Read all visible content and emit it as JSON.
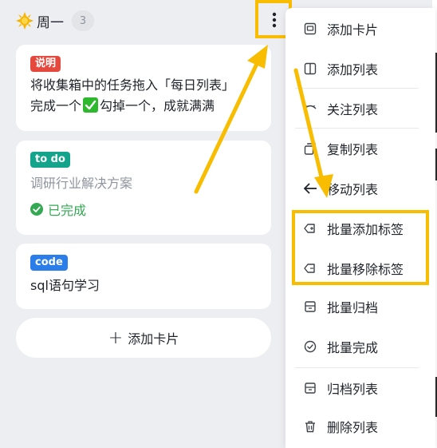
{
  "list": {
    "title": "周一",
    "count": "3"
  },
  "cards": [
    {
      "tag": "说明",
      "tag_color": "#e5483d",
      "text_a": "将收集箱中的任务拖入「每日列表」",
      "text_b1": "完成一个",
      "text_b2": "勾掉一个，成就满满"
    },
    {
      "tag": "to do",
      "tag_color": "#14a38b",
      "text": "调研行业解决方案",
      "status": "已完成"
    },
    {
      "tag": "code",
      "tag_color": "#2b7de9",
      "text": "sql语句学习"
    }
  ],
  "add_card_label": "添加卡片",
  "menu": {
    "items": [
      {
        "label": "添加卡片",
        "icon": "card-icon"
      },
      {
        "label": "添加列表",
        "icon": "columns-icon"
      },
      {
        "label": "关注列表",
        "icon": "eye-icon"
      },
      {
        "label": "复制列表",
        "icon": "copy-icon"
      },
      {
        "label": "移动列表",
        "icon": "arrow-left-icon"
      },
      {
        "label": "批量添加标签",
        "icon": "tag-add-icon"
      },
      {
        "label": "批量移除标签",
        "icon": "tag-remove-icon"
      },
      {
        "label": "批量归档",
        "icon": "archive-icon"
      },
      {
        "label": "批量完成",
        "icon": "check-circle-icon"
      },
      {
        "label": "归档列表",
        "icon": "archive-list-icon"
      },
      {
        "label": "删除列表",
        "icon": "trash-icon"
      }
    ]
  },
  "colors": {
    "highlight": "#f8bd00",
    "done_green": "#34a853"
  }
}
